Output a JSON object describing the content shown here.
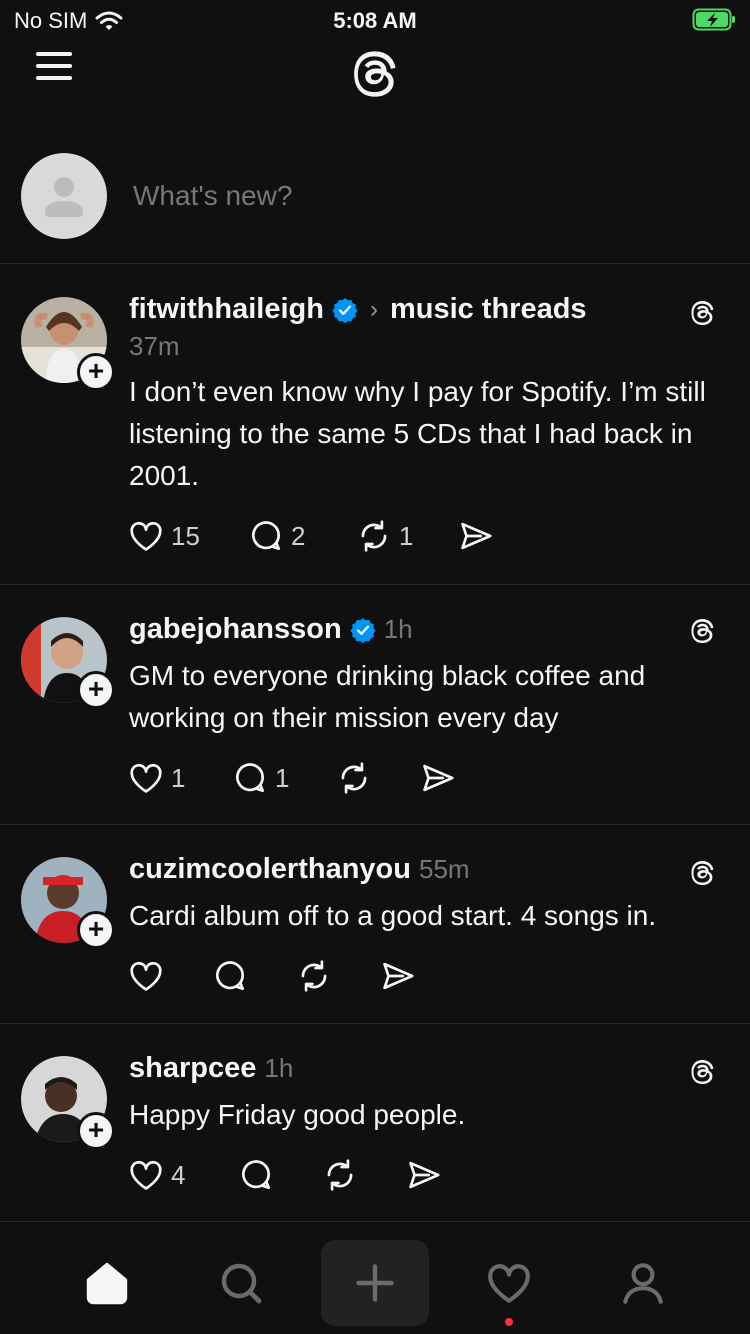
{
  "status_bar": {
    "carrier": "No SIM",
    "time": "5:08 AM",
    "battery_color": "#4cd964"
  },
  "composer": {
    "placeholder": "What's new?"
  },
  "posts": [
    {
      "username": "fitwithhaileigh",
      "verified": true,
      "topic": "music threads",
      "time": "37m",
      "text": "I don’t even know why I pay for Spotify. I’m still listening to the same 5 CDs that I had back in 2001.",
      "likes": "15",
      "replies": "2",
      "reposts": "1"
    },
    {
      "username": "gabejohansson",
      "verified": true,
      "time": "1h",
      "text": "GM to everyone drinking black coffee and working on their mission every day",
      "likes": "1",
      "replies": "1",
      "reposts": ""
    },
    {
      "username": "cuzimcoolerthanyou",
      "verified": false,
      "time": "55m",
      "text": "Cardi album off to a good start. 4 songs in.",
      "likes": "",
      "replies": "",
      "reposts": ""
    },
    {
      "username": "sharpcee",
      "verified": false,
      "time": "1h",
      "text": "Happy Friday good people.",
      "likes": "4",
      "replies": "",
      "reposts": ""
    }
  ],
  "colors": {
    "background": "#101010",
    "text": "#f3f5f7",
    "muted": "#777777",
    "verified": "#0095f6",
    "notification": "#ff3040"
  },
  "bottom_nav": [
    "home-icon",
    "search-icon",
    "compose-plus-icon",
    "activity-heart-icon",
    "profile-icon"
  ]
}
